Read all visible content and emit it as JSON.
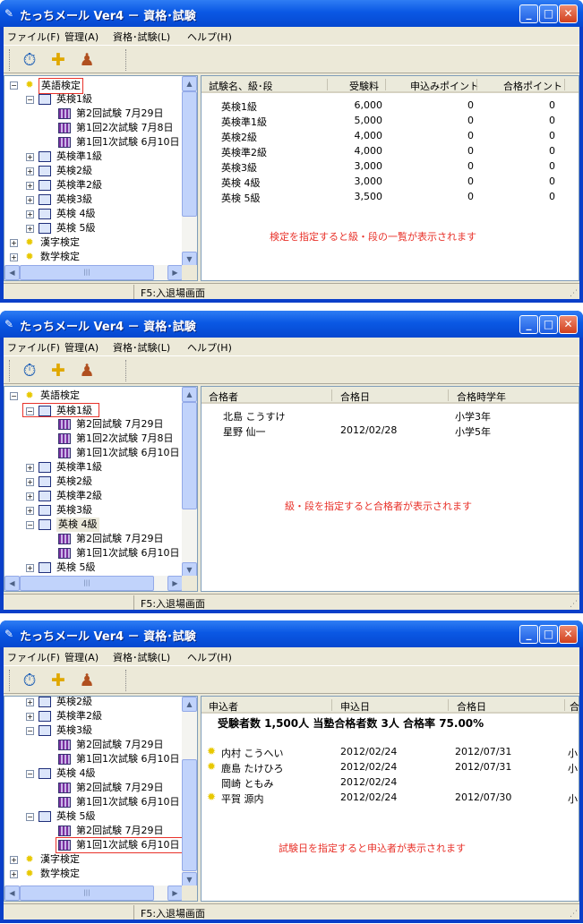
{
  "app_title": "たっちメール Ver4 － 資格･試験",
  "menu": [
    "ファイル(F)",
    "管理(A)",
    "資格･試験(L)",
    "ヘルプ(H)"
  ],
  "status_text": "F5:入退場画面",
  "win1": {
    "tree": [
      "英語検定",
      "英検1級",
      "第2回試験 7月29日",
      "第1回2次試験 7月8日",
      "第1回1次試験 6月10日",
      "英検準1級",
      "英検2級",
      "英検準2級",
      "英検3級",
      "英検 4級",
      "英検 5級",
      "漢字検定",
      "数学検定"
    ],
    "headers": [
      "試験名、級･段",
      "受験料",
      "申込みポイント",
      "合格ポイント"
    ],
    "rows": [
      [
        "英検1級",
        "6,000",
        "0",
        "0"
      ],
      [
        "英検準1級",
        "5,000",
        "0",
        "0"
      ],
      [
        "英検2級",
        "4,000",
        "0",
        "0"
      ],
      [
        "英検準2級",
        "4,000",
        "0",
        "0"
      ],
      [
        "英検3級",
        "3,000",
        "0",
        "0"
      ],
      [
        "英検 4級",
        "3,000",
        "0",
        "0"
      ],
      [
        "英検 5級",
        "3,500",
        "0",
        "0"
      ]
    ],
    "note": "検定を指定すると級・段の一覧が表示されます"
  },
  "win2": {
    "tree": [
      "英語検定",
      "英検1級",
      "第2回試験 7月29日",
      "第1回2次試験 7月8日",
      "第1回1次試験 6月10日",
      "英検準1級",
      "英検2級",
      "英検準2級",
      "英検3級",
      "英検 4級",
      "第2回試験 7月29日",
      "第1回1次試験 6月10日",
      "英検 5級"
    ],
    "headers": [
      "合格者",
      "合格日",
      "合格時学年"
    ],
    "rows": [
      [
        "北島 こうすけ",
        "",
        "小学3年"
      ],
      [
        "星野 仙一",
        "2012/02/28",
        "小学5年"
      ]
    ],
    "note": "級・段を指定すると合格者が表示されます"
  },
  "win3": {
    "tree": [
      "英検2級",
      "英検準2級",
      "英検3級",
      "第2回試験 7月29日",
      "第1回1次試験 6月10日",
      "英検 4級",
      "第2回試験 7月29日",
      "第1回1次試験 6月10日",
      "英検 5級",
      "第2回試験 7月29日",
      "第1回1次試験 6月10日",
      "漢字検定",
      "数学検定"
    ],
    "headers": [
      "申込者",
      "申込日",
      "合格日",
      "合"
    ],
    "summary": "受験者数 1,500人 当塾合格者数 3人 合格率 75.00%",
    "rows": [
      [
        "内村 こうへい",
        "2012/02/24",
        "2012/07/31",
        "小"
      ],
      [
        "鹿島 たけひろ",
        "2012/02/24",
        "2012/07/31",
        "小"
      ],
      [
        "岡崎 ともみ",
        "2012/02/24",
        "",
        ""
      ],
      [
        "平賀 源内",
        "2012/02/24",
        "2012/07/30",
        "小"
      ]
    ],
    "note": "試験日を指定すると申込者が表示されます"
  }
}
